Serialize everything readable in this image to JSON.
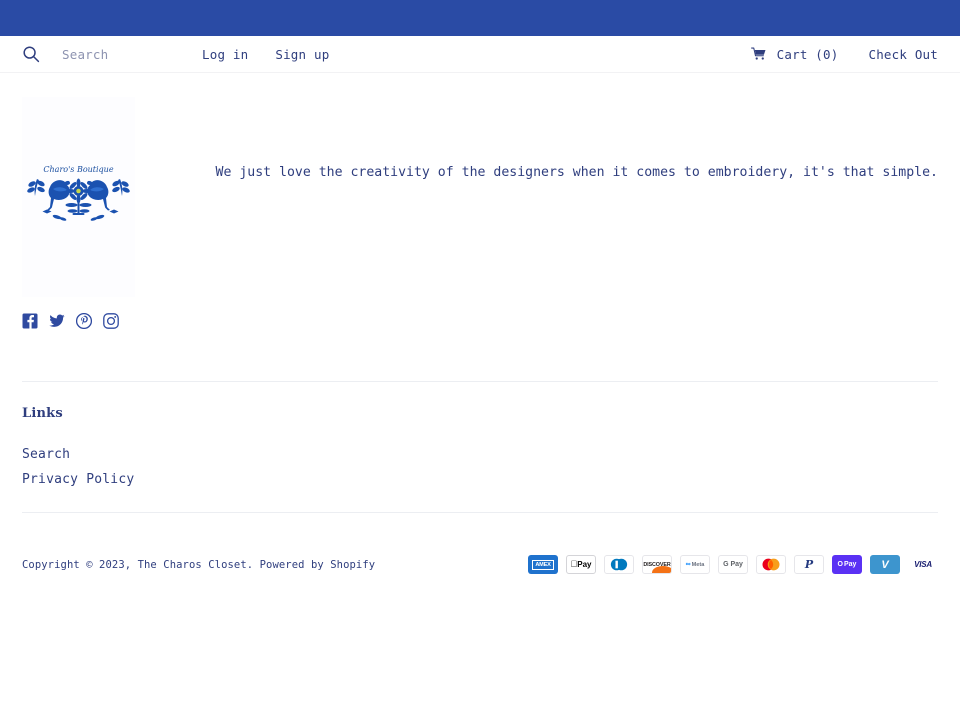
{
  "theme": {
    "accent_blue": "#2a4ba5",
    "text_blue": "#2f3e7e",
    "placeholder_gray": "#8d93b0",
    "divider_gray": "#eceef2",
    "logo_bg": "#fdfdff"
  },
  "header": {
    "search": {
      "icon": "search-icon",
      "value": "",
      "placeholder": "Search"
    },
    "nav": [
      {
        "label": "Log in",
        "name": "log-in"
      },
      {
        "label": "Sign up",
        "name": "sign-up"
      }
    ],
    "cart": {
      "icon": "shopping-cart-icon",
      "label": "Cart (0)",
      "count": 0
    },
    "checkout_label": "Check Out"
  },
  "main": {
    "logo": {
      "name": "charos-boutique-logo",
      "wordmark": "Charo's Boutique",
      "alt": "Charo's Boutique logo with two blue birds, flower and leaves"
    },
    "tagline": "We just love the creativity of the designers when it comes to embroidery, it's that simple."
  },
  "social": [
    {
      "name": "facebook-icon",
      "label": "Facebook"
    },
    {
      "name": "twitter-icon",
      "label": "Twitter"
    },
    {
      "name": "pinterest-icon",
      "label": "Pinterest"
    },
    {
      "name": "instagram-icon",
      "label": "Instagram"
    }
  ],
  "footer": {
    "links_heading": "Links",
    "links": [
      {
        "label": "Search",
        "name": "search"
      },
      {
        "label": "Privacy Policy",
        "name": "privacy-policy"
      }
    ],
    "copyright": "Copyright © 2023,",
    "shop_name": "The Charos Closet.",
    "powered_by_prefix": "Powered by",
    "powered_by": "Shopify",
    "payments": [
      {
        "name": "american-express",
        "label": "AMEX"
      },
      {
        "name": "apple-pay",
        "label": "Pay"
      },
      {
        "name": "diners-club",
        "label": "Diners Club"
      },
      {
        "name": "discover",
        "label": "DISCOVER"
      },
      {
        "name": "meta-pay",
        "label": "Meta"
      },
      {
        "name": "google-pay",
        "label": "G Pay"
      },
      {
        "name": "mastercard",
        "label": "Mastercard"
      },
      {
        "name": "paypal",
        "label": "PayPal"
      },
      {
        "name": "shop-pay",
        "label": "Pay"
      },
      {
        "name": "venmo",
        "label": "V"
      },
      {
        "name": "visa",
        "label": "VISA"
      }
    ]
  }
}
